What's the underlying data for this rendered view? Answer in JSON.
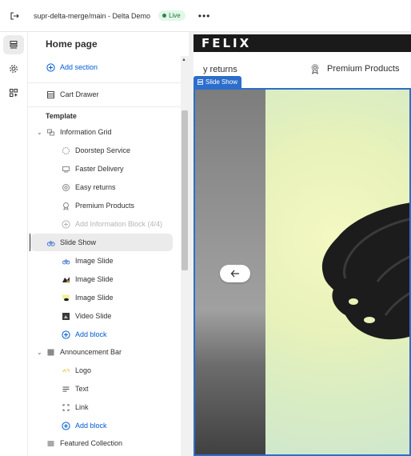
{
  "topbar": {
    "store_name": "supr-delta-merge/main - Delta Demo",
    "status": "Live",
    "more_label": "•••"
  },
  "panel": {
    "title": "Home page",
    "add_section": "Add section",
    "cart_drawer": "Cart Drawer",
    "template_heading": "Template",
    "sections": [
      {
        "name": "Information Grid",
        "blocks": [
          "Doorstep Service",
          "Faster Delivery",
          "Easy returns",
          "Premium Products"
        ],
        "add_block": "Add Information Block (4/4)"
      },
      {
        "name": "Slide Show",
        "blocks": [
          "Image Slide",
          "Image Slide",
          "Image Slide",
          "Video Slide"
        ],
        "add_block": "Add block"
      },
      {
        "name": "Announcement Bar",
        "blocks": [
          "Logo",
          "Text",
          "Link"
        ],
        "add_block": "Add block"
      },
      {
        "name": "Featured Collection",
        "blocks": [],
        "add_block": ""
      }
    ]
  },
  "preview": {
    "logo": "FELIX",
    "announcement_left": "y returns",
    "announcement_right": "Premium Products",
    "slide_tag": "Slide Show"
  },
  "colors": {
    "accent": "#005bd3",
    "live_badge_bg": "#e3f7e8",
    "selection": "#2c6ecb"
  }
}
